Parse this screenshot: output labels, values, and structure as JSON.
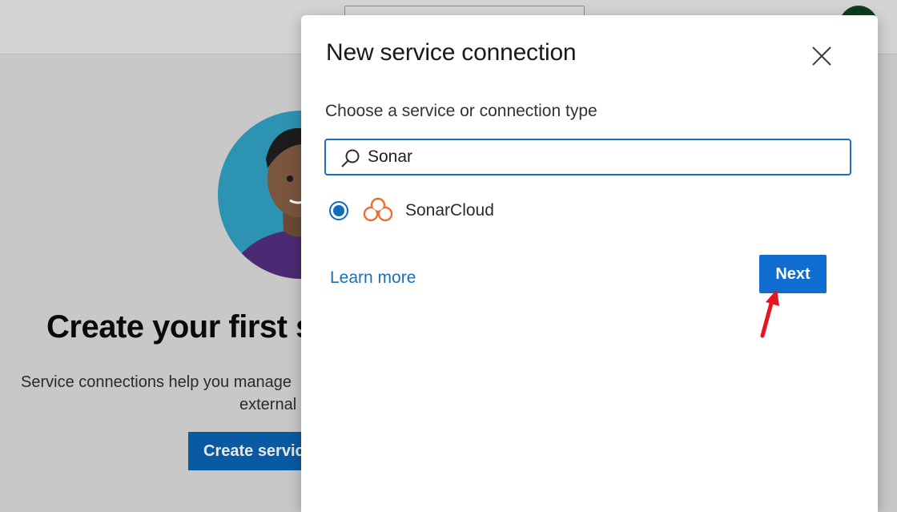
{
  "background": {
    "title": "Create your first s",
    "description_line1": "Service connections help you manage",
    "description_line2": "external",
    "button_label": "Create servic"
  },
  "modal": {
    "title": "New service connection",
    "subtitle": "Choose a service or connection type",
    "search": {
      "value": "Sonar",
      "icon": "search-icon"
    },
    "options": [
      {
        "label": "SonarCloud",
        "selected": true,
        "icon": "sonarcloud-icon",
        "icon_color": "#f26b2b"
      }
    ],
    "learn_more": "Learn more",
    "next_label": "Next"
  },
  "colors": {
    "accent": "#0f6cd0",
    "link": "#1a6fb4",
    "annotation_arrow": "#e8151f"
  }
}
